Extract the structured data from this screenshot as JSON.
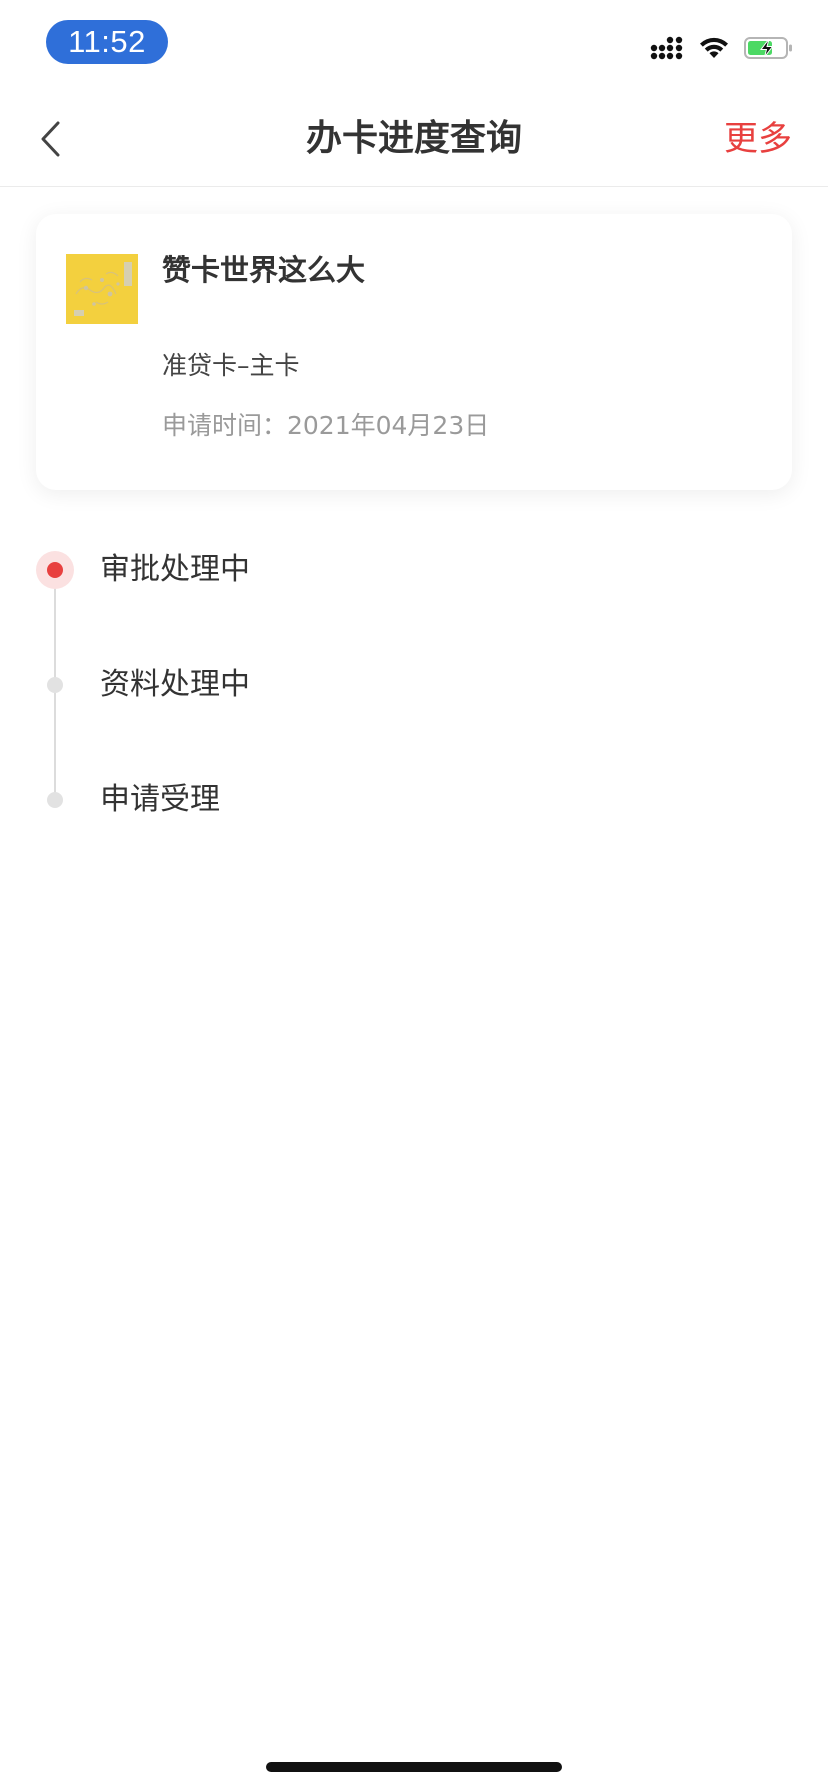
{
  "status_bar": {
    "time": "11:52",
    "battery_color": "#4cd964",
    "icons": [
      "signal-icon",
      "wifi-icon",
      "battery-charging-icon"
    ]
  },
  "nav": {
    "back_icon": "chevron-left-icon",
    "title": "办卡进度查询",
    "more_label": "更多",
    "accent_color": "#e8403f"
  },
  "card": {
    "name": "赞卡世界这么大",
    "type": "准贷卡–主卡",
    "apply_time": "申请时间：2021年04月23日",
    "thumb_color": "#f3d03e"
  },
  "timeline": {
    "steps": [
      {
        "label": "审批处理中",
        "active": true
      },
      {
        "label": "资料处理中",
        "active": false
      },
      {
        "label": "申请受理",
        "active": false
      }
    ]
  }
}
